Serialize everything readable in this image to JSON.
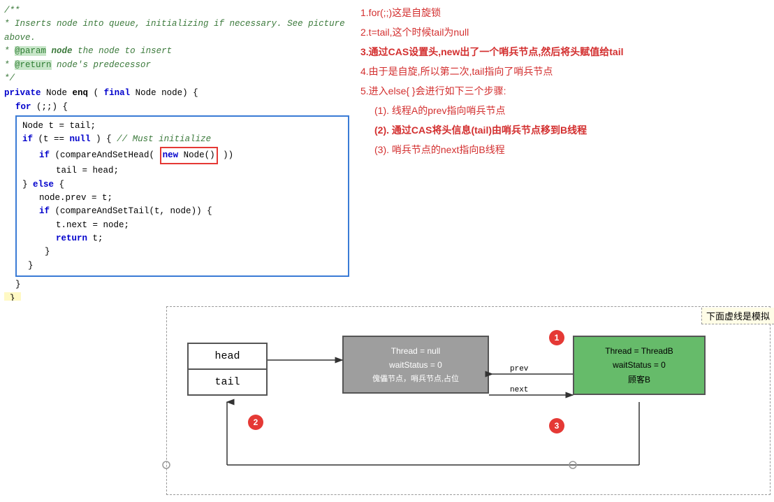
{
  "code": {
    "comment_lines": [
      "/**",
      " * Inserts node into queue, initializing if necessary. See picture above.",
      " * @param node the node to insert",
      " * @return node's predecessor",
      " */"
    ],
    "signature": "private Node enq(final Node node) {",
    "body": [
      "    for (;;) {",
      "        Node t = tail;",
      "        if (t == null) { // Must initialize",
      "            if (compareAndSetHead(new Node()))",
      "                tail = head;",
      "        } else {",
      "            node.prev = t;",
      "            if (compareAndSetTail(t, node)) {",
      "                t.next = node;",
      "                return t;",
      "            }",
      "        }",
      "    }",
      "}"
    ]
  },
  "annotations": {
    "items": [
      "1.for(;;)这是自旋锁",
      "2.t=tail,这个时候tail为null",
      "3.通过CAS设置头,new出了一个哨兵节点,然后将头赋值给tail",
      "4.由于是自旋,所以第二次,tail指向了哨兵节点",
      "5.进入else{ }会进行如下三个步骤:",
      "  (1). 线程A的prev指向哨兵节点",
      "  (2). 通过CAS将头信息(tail)由哨兵节点移到B线程",
      "  (3). 哨兵节点的next指向B线程"
    ]
  },
  "diagram": {
    "dashed_label": "下面虚线是模拟",
    "head_label": "head",
    "tail_label": "tail",
    "sentinel": {
      "line1": "Thread = null",
      "line2": "waitStatus = 0",
      "line3": "傀儡节点，哨兵节点,占位"
    },
    "threadb": {
      "line1": "Thread = ThreadB",
      "line2": "waitStatus = 0",
      "line3": "顾客B"
    },
    "arrow_prev": "prev",
    "arrow_next": "next",
    "badges": [
      "1",
      "2",
      "3"
    ]
  },
  "colors": {
    "keyword": "#0000cc",
    "comment": "#3c7a3c",
    "red_annotation": "#d32f2f",
    "blue_border": "#3a7bd5",
    "red_border": "#e53935",
    "sentinel_bg": "#9e9e9e",
    "threadb_bg": "#66bb6a",
    "badge_bg": "#e53935",
    "yellow_bg": "#fff9c4"
  }
}
